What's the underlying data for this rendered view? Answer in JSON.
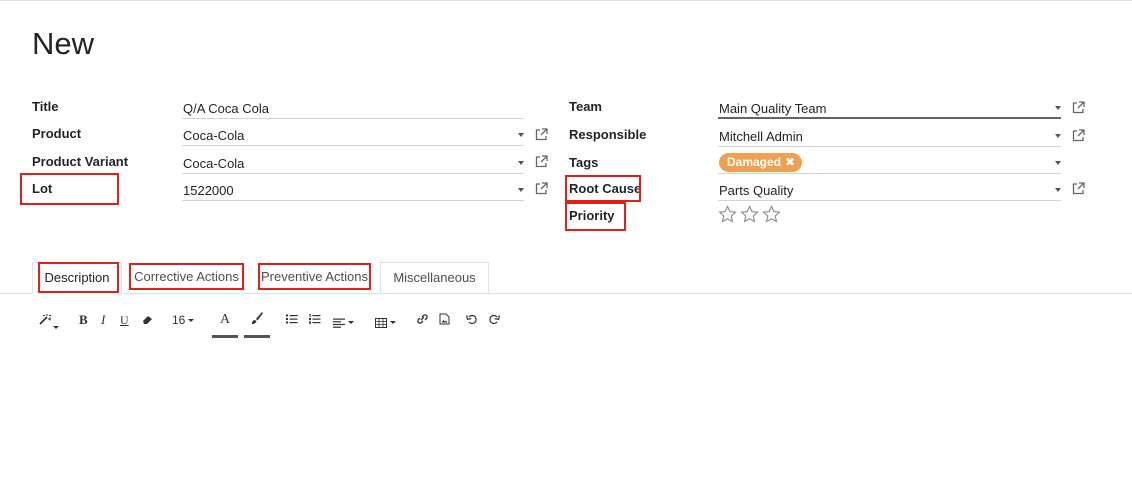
{
  "page": {
    "title": "New"
  },
  "form": {
    "left": [
      {
        "label": "Title",
        "value": "Q/A Coca Cola"
      },
      {
        "label": "Product",
        "value": "Coca-Cola"
      },
      {
        "label": "Product Variant",
        "value": "Coca-Cola"
      },
      {
        "label": "Lot",
        "value": "1522000"
      }
    ],
    "right": [
      {
        "label": "Team",
        "value": "Main Quality Team"
      },
      {
        "label": "Responsible",
        "value": "Mitchell Admin"
      },
      {
        "label": "Tags",
        "value": ""
      },
      {
        "label": "Root Cause",
        "value": "Parts Quality"
      },
      {
        "label": "Priority",
        "value": ""
      }
    ],
    "tags": [
      {
        "label": "Damaged",
        "color": "#f0a050"
      }
    ],
    "priority": {
      "stars_filled": 0,
      "stars_total": 3
    }
  },
  "tabs": [
    {
      "label": "Description",
      "active": true
    },
    {
      "label": "Corrective Actions",
      "active": false
    },
    {
      "label": "Preventive Actions",
      "active": false
    },
    {
      "label": "Miscellaneous",
      "active": false
    }
  ],
  "toolbar": {
    "bold": "B",
    "italic": "I",
    "underline": "U",
    "font_size": "16",
    "font_color": "A",
    "icons": [
      "magic-wand-icon",
      "eraser-icon",
      "paintbrush-icon",
      "unordered-list-icon",
      "ordered-list-icon",
      "align-icon",
      "table-icon",
      "link-icon",
      "image-icon",
      "undo-icon",
      "redo-icon"
    ]
  },
  "annotations": {
    "highlight_color": "#e0201b"
  }
}
